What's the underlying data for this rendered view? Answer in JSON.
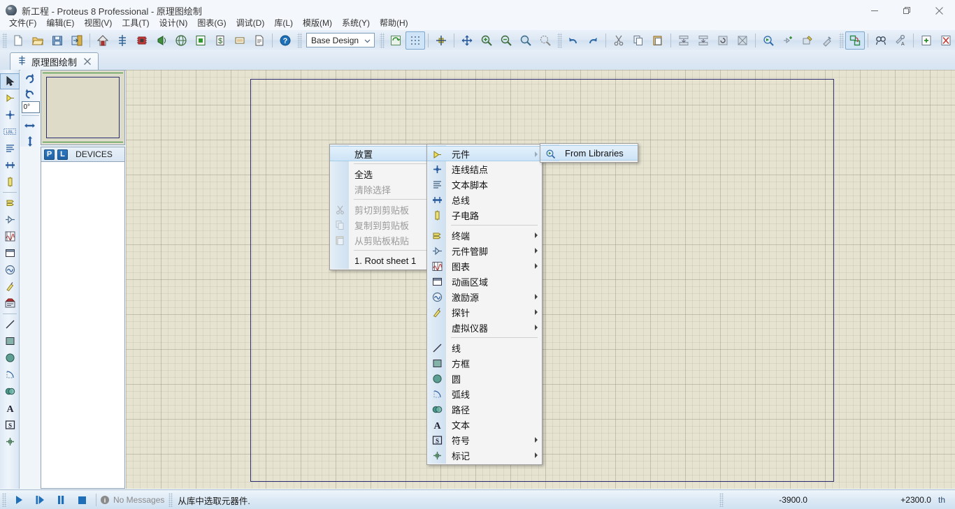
{
  "window": {
    "title": "新工程 - Proteus 8 Professional - 原理图绘制",
    "app_icon": "proteus-sphere-icon",
    "minimize_label": "最小化",
    "maximize_label": "还原",
    "close_label": "关闭"
  },
  "menubar": {
    "items": [
      {
        "label": "文件(F)",
        "name": "menu-file"
      },
      {
        "label": "编辑(E)",
        "name": "menu-edit"
      },
      {
        "label": "视图(V)",
        "name": "menu-view"
      },
      {
        "label": "工具(T)",
        "name": "menu-tools"
      },
      {
        "label": "设计(N)",
        "name": "menu-design"
      },
      {
        "label": "图表(G)",
        "name": "menu-graph"
      },
      {
        "label": "调试(D)",
        "name": "menu-debug"
      },
      {
        "label": "库(L)",
        "name": "menu-library"
      },
      {
        "label": "模版(M)",
        "name": "menu-template"
      },
      {
        "label": "系统(Y)",
        "name": "menu-system"
      },
      {
        "label": "帮助(H)",
        "name": "menu-help"
      }
    ]
  },
  "toolbar": {
    "design_selector_value": "Base Design",
    "groups": [
      [
        "new-file-icon",
        "open-folder-icon",
        "save-icon",
        "save-as-exit-icon"
      ],
      [
        "home-icon",
        "schematic-capture-icon",
        "pcb-layout-icon",
        "3d-viewer-icon",
        "bill-of-materials-icon",
        "source-code-icon",
        "billing-icon",
        "report-icon",
        "document-icon",
        "help-icon"
      ],
      [
        "refresh-icon",
        "grid-toggle-icon"
      ],
      [
        "origin-icon"
      ],
      [
        "pan-icon",
        "zoom-in-icon",
        "zoom-out-icon",
        "zoom-area-icon",
        "zoom-to-fit-icon"
      ],
      [
        "undo-icon",
        "redo-icon"
      ],
      [
        "cut-icon",
        "copy-icon",
        "paste-icon"
      ],
      [
        "block-copy-icon",
        "block-move-icon",
        "block-rotate-icon",
        "block-delete-icon"
      ],
      [
        "pick-device-icon",
        "make-device-icon",
        "packaging-tool-icon",
        "decompose-icon"
      ],
      [
        "property-assignment-icon"
      ],
      [
        "search-icon",
        "property-tool-icon"
      ],
      [
        "new-sheet-icon",
        "remove-sheet-icon",
        "goto-sheet-icon"
      ],
      [
        "netlist-icon"
      ]
    ]
  },
  "tab": {
    "label": "原理图绘制",
    "icon": "schematic-icon",
    "close_icon": "close-icon"
  },
  "left_toolbar": {
    "tools": [
      {
        "name": "selection-mode-tool",
        "icon": "arrow-cursor-icon",
        "selected": true
      },
      {
        "name": "component-mode-tool",
        "icon": "component-icon",
        "selected": false
      },
      {
        "name": "junction-dot-tool",
        "icon": "junction-icon",
        "selected": false
      },
      {
        "name": "wire-label-tool",
        "icon": "label-icon",
        "selected": false
      },
      {
        "name": "text-script-tool",
        "icon": "text-script-icon",
        "selected": false
      },
      {
        "name": "bus-tool",
        "icon": "bus-icon",
        "selected": false
      },
      {
        "name": "subcircuit-tool",
        "icon": "subcircuit-icon",
        "selected": false
      },
      {
        "name": "terminals-tool",
        "icon": "terminal-icon",
        "selected": false
      },
      {
        "name": "device-pin-tool",
        "icon": "device-pin-icon",
        "selected": false
      },
      {
        "name": "graph-tool",
        "icon": "graph-icon",
        "selected": false
      },
      {
        "name": "tape-recorder-tool",
        "icon": "animation-frame-icon",
        "selected": false
      },
      {
        "name": "generator-tool",
        "icon": "generator-icon",
        "selected": false
      },
      {
        "name": "probe-tool",
        "icon": "probe-icon",
        "selected": false
      },
      {
        "name": "virtual-instrument-tool",
        "icon": "instrument-icon",
        "selected": false
      },
      {
        "name": "line-tool",
        "icon": "line-icon",
        "selected": false
      },
      {
        "name": "box-tool",
        "icon": "box-icon",
        "selected": false
      },
      {
        "name": "circle-tool",
        "icon": "circle-icon",
        "selected": false
      },
      {
        "name": "arc-tool",
        "icon": "arc-icon",
        "selected": false
      },
      {
        "name": "path-tool",
        "icon": "path-icon",
        "selected": false
      },
      {
        "name": "text-tool",
        "icon": "text-icon",
        "selected": false
      },
      {
        "name": "symbol-tool",
        "icon": "symbol-icon",
        "selected": false
      },
      {
        "name": "marker-tool",
        "icon": "marker-icon",
        "selected": false
      }
    ],
    "rotation": {
      "rotate-cw": "rotate-clockwise-icon",
      "rotate-ccw": "rotate-counterclockwise-icon",
      "angle_value": "0°",
      "mirror-x": "mirror-horizontal-icon",
      "mirror-y": "mirror-vertical-icon"
    }
  },
  "devices_panel": {
    "p_button": "P",
    "l_button": "L",
    "title": "DEVICES",
    "items": []
  },
  "context_menu": {
    "title": "放置",
    "items": [
      {
        "label": "放置",
        "name": "cm-place",
        "icon": null,
        "submenu": true,
        "highlighted": true,
        "disabled": false
      },
      {
        "sep": true
      },
      {
        "label": "全选",
        "name": "cm-select-all",
        "icon": null,
        "submenu": false,
        "highlighted": false,
        "disabled": false,
        "underline_first": true
      },
      {
        "label": "清除选择",
        "name": "cm-clear-selection",
        "icon": null,
        "submenu": false,
        "highlighted": false,
        "disabled": true
      },
      {
        "sep": true
      },
      {
        "label": "剪切到剪贴板",
        "name": "cm-cut",
        "icon": "scissors-icon",
        "submenu": false,
        "highlighted": false,
        "disabled": true
      },
      {
        "label": "复制到剪贴板",
        "name": "cm-copy",
        "icon": "copy-icon",
        "submenu": false,
        "highlighted": false,
        "disabled": true
      },
      {
        "label": "从剪贴板粘贴",
        "name": "cm-paste",
        "icon": "paste-icon",
        "submenu": false,
        "highlighted": false,
        "disabled": true
      },
      {
        "sep": true
      },
      {
        "label": "1. Root sheet 1",
        "name": "cm-root-sheet-1",
        "icon": null,
        "submenu": false,
        "highlighted": false,
        "disabled": false,
        "underline_first": true
      }
    ]
  },
  "place_submenu": {
    "items": [
      {
        "label": "元件",
        "name": "sm-component",
        "icon": "component-icon",
        "submenu": true,
        "highlighted": true
      },
      {
        "label": "连线结点",
        "name": "sm-junction-dot",
        "icon": "junction-icon",
        "submenu": false,
        "highlighted": false
      },
      {
        "label": "文本脚本",
        "name": "sm-text-script",
        "icon": "text-script-icon",
        "submenu": false,
        "highlighted": false
      },
      {
        "label": "总线",
        "name": "sm-bus",
        "icon": "bus-icon",
        "submenu": false,
        "highlighted": false
      },
      {
        "label": "子电路",
        "name": "sm-subcircuit",
        "icon": "subcircuit-icon",
        "submenu": false,
        "highlighted": false
      },
      {
        "sep": true
      },
      {
        "label": "终端",
        "name": "sm-terminal",
        "icon": "terminal-icon",
        "submenu": true,
        "highlighted": false
      },
      {
        "label": "元件管脚",
        "name": "sm-device-pin",
        "icon": "device-pin-icon",
        "submenu": true,
        "highlighted": false
      },
      {
        "label": "图表",
        "name": "sm-graph",
        "icon": "graph-icon",
        "submenu": true,
        "highlighted": false
      },
      {
        "label": "动画区域",
        "name": "sm-animation-frame",
        "icon": "animation-frame-icon",
        "submenu": false,
        "highlighted": false
      },
      {
        "label": "激励源",
        "name": "sm-generator",
        "icon": "generator-icon",
        "submenu": true,
        "highlighted": false
      },
      {
        "label": "探针",
        "name": "sm-probe",
        "icon": "probe-icon",
        "submenu": true,
        "highlighted": false
      },
      {
        "label": "虚拟仪器",
        "name": "sm-virtual-instrument",
        "icon": "instrument-icon",
        "submenu": true,
        "highlighted": false
      },
      {
        "sep": true
      },
      {
        "label": "线",
        "name": "sm-line",
        "icon": "line-icon",
        "submenu": false,
        "highlighted": false
      },
      {
        "label": "方框",
        "name": "sm-box",
        "icon": "box-icon",
        "submenu": false,
        "highlighted": false
      },
      {
        "label": "圆",
        "name": "sm-circle",
        "icon": "circle-icon",
        "submenu": false,
        "highlighted": false
      },
      {
        "label": "弧线",
        "name": "sm-arc",
        "icon": "arc-icon",
        "submenu": false,
        "highlighted": false
      },
      {
        "label": "路径",
        "name": "sm-path",
        "icon": "path-icon",
        "submenu": false,
        "highlighted": false
      },
      {
        "label": "文本",
        "name": "sm-text",
        "icon": "text-icon",
        "submenu": false,
        "highlighted": false
      },
      {
        "label": "符号",
        "name": "sm-symbol",
        "icon": "symbol-icon",
        "submenu": true,
        "highlighted": false
      },
      {
        "label": "标记",
        "name": "sm-marker",
        "icon": "marker-icon",
        "submenu": true,
        "highlighted": false
      }
    ]
  },
  "component_submenu": {
    "items": [
      {
        "label": "From Libraries",
        "name": "sm-from-libraries",
        "icon": "pick-device-icon",
        "highlighted": true
      }
    ]
  },
  "statusbar": {
    "play_icon": "play-icon",
    "step_icon": "step-icon",
    "pause_icon": "pause-icon",
    "stop_icon": "stop-icon",
    "messages": "No Messages",
    "messages_icon": "info-icon",
    "hint": "从库中选取元器件.",
    "coord_x": "-3900.0",
    "coord_y": "+2300.0",
    "units": "th"
  },
  "colors": {
    "accent": "#2f7bc4",
    "canvas_bg": "#e6e3d0",
    "sheet_border": "#2b2f72",
    "menu_highlight": "#cde4f7",
    "toolbar_bg": "#dde8f4"
  }
}
